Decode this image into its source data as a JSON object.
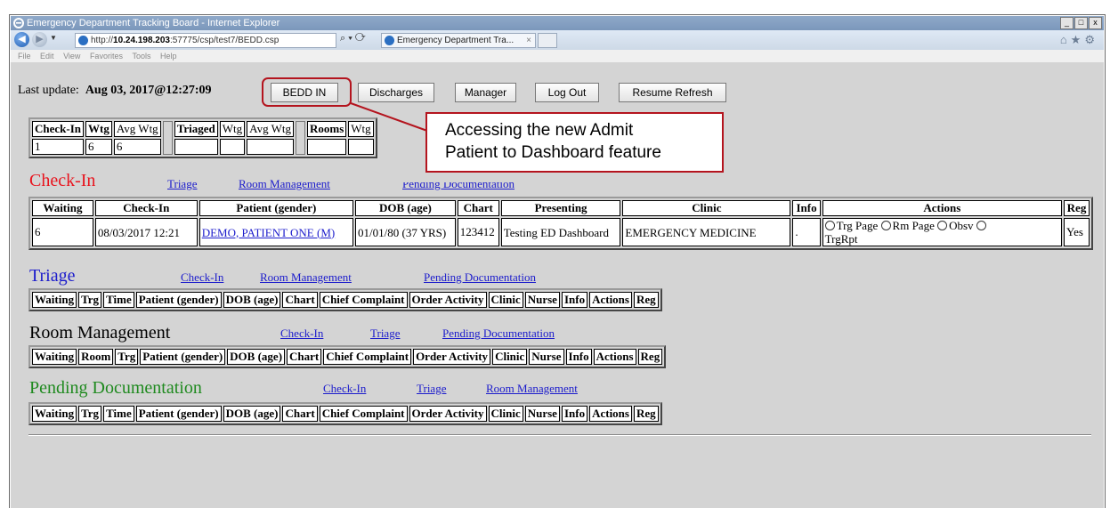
{
  "window": {
    "title": "Emergency Department Tracking Board - Internet Explorer"
  },
  "browser": {
    "url_prefix": "http://",
    "url_host": "10.24.198.203",
    "url_rest": ":57775/csp/test7/BEDD.csp",
    "tab_title": "Emergency Department Tra...",
    "menu": [
      "File",
      "Edit",
      "View",
      "Favorites",
      "Tools",
      "Help"
    ]
  },
  "header": {
    "last_update_label": "Last update:",
    "last_update_value": "Aug 03, 2017@12:27:09",
    "buttons": [
      "BEDD IN",
      "Discharges",
      "Manager",
      "Log Out",
      "Resume Refresh"
    ]
  },
  "callout": {
    "line1": "Accessing the new Admit",
    "line2": "Patient to Dashboard feature"
  },
  "summary": {
    "headers": [
      "Check-In",
      "Wtg",
      "Avg Wtg",
      "Triaged",
      "Wtg",
      "Avg Wtg",
      "Rooms",
      "Wtg"
    ],
    "values": [
      "1",
      "6",
      "6"
    ]
  },
  "checkin": {
    "title": "Check-In",
    "links": [
      "Triage",
      "Room Management",
      "Pending Documentation"
    ],
    "headers": [
      "Waiting",
      "Check-In",
      "Patient (gender)",
      "DOB (age)",
      "Chart",
      "Presenting",
      "Clinic",
      "Info",
      "Actions",
      "Reg"
    ],
    "row": {
      "waiting": "6",
      "checkin": "08/03/2017 12:21",
      "patient": "DEMO, PATIENT ONE (M)",
      "dob": "01/01/80 (37 YRS)",
      "chart": "123412",
      "presenting": "Testing ED Dashboard",
      "clinic": "EMERGENCY MEDICINE",
      "info": ".",
      "actions": [
        "Trg Page",
        "Rm Page",
        "Obsv",
        "TrgRpt"
      ],
      "reg": "Yes"
    }
  },
  "triage": {
    "title": "Triage",
    "links": [
      "Check-In",
      "Room Management",
      "Pending Documentation"
    ],
    "headers": [
      "Waiting",
      "Trg",
      "Time",
      "Patient (gender)",
      "DOB (age)",
      "Chart",
      "Chief Complaint",
      "Order Activity",
      "Clinic",
      "Nurse",
      "Info",
      "Actions",
      "Reg"
    ]
  },
  "room": {
    "title": "Room Management",
    "links": [
      "Check-In",
      "Triage",
      "Pending Documentation"
    ],
    "headers": [
      "Waiting",
      "Room",
      "Trg",
      "Patient (gender)",
      "DOB (age)",
      "Chart",
      "Chief Complaint",
      "Order Activity",
      "Clinic",
      "Nurse",
      "Info",
      "Actions",
      "Reg"
    ]
  },
  "pending": {
    "title": "Pending Documentation",
    "links": [
      "Check-In",
      "Triage",
      "Room Management"
    ],
    "headers": [
      "Waiting",
      "Trg",
      "Time",
      "Patient (gender)",
      "DOB (age)",
      "Chart",
      "Chief Complaint",
      "Order Activity",
      "Clinic",
      "Nurse",
      "Info",
      "Actions",
      "Reg"
    ]
  },
  "colors": {
    "checkin_title": "#e8141e",
    "triage_title": "#1c1ccc",
    "room_title": "#000000",
    "pending_title": "#1f8a1f",
    "highlight": "#b4141e"
  }
}
